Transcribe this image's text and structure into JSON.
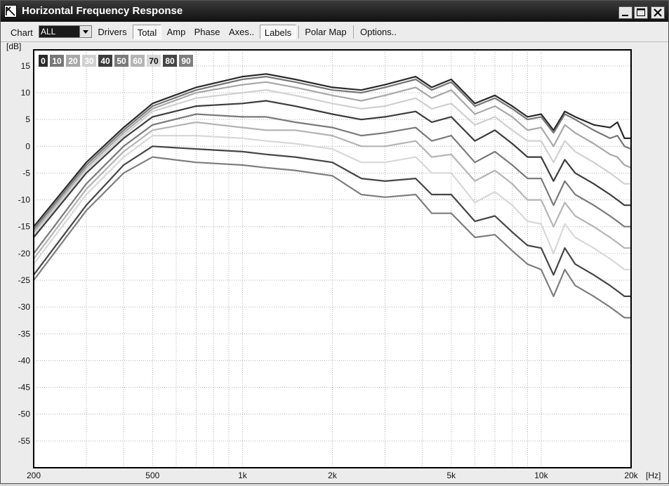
{
  "window": {
    "title": "Horizontal Frequency Response"
  },
  "toolbar": {
    "chart_label": "Chart",
    "chart_select_value": "ALL",
    "drivers": "Drivers",
    "total": "Total",
    "amp": "Amp",
    "phase": "Phase",
    "axes": "Axes..",
    "labels": "Labels",
    "polar_map": "Polar Map",
    "options": "Options.."
  },
  "chart_data": {
    "type": "line",
    "xscale": "log",
    "xlim": [
      200,
      20000
    ],
    "ylim": [
      -60,
      18
    ],
    "grid": true,
    "xunit": "[Hz]",
    "yunit": "[dB]",
    "x_ticks": [
      {
        "value": 200,
        "label": "200"
      },
      {
        "value": 500,
        "label": "500"
      },
      {
        "value": 1000,
        "label": "1k"
      },
      {
        "value": 2000,
        "label": "2k"
      },
      {
        "value": 5000,
        "label": "5k"
      },
      {
        "value": 10000,
        "label": "10k"
      },
      {
        "value": 20000,
        "label": "20k"
      }
    ],
    "y_ticks": [
      {
        "value": 15,
        "label": "15"
      },
      {
        "value": 10,
        "label": "10"
      },
      {
        "value": 5,
        "label": "5"
      },
      {
        "value": 0,
        "label": "0"
      },
      {
        "value": -5,
        "label": "-5"
      },
      {
        "value": -10,
        "label": "-10"
      },
      {
        "value": -15,
        "label": "-15"
      },
      {
        "value": -20,
        "label": "-20"
      },
      {
        "value": -25,
        "label": "-25"
      },
      {
        "value": -30,
        "label": "-30"
      },
      {
        "value": -35,
        "label": "-35"
      },
      {
        "value": -40,
        "label": "-40"
      },
      {
        "value": -45,
        "label": "-45"
      },
      {
        "value": -50,
        "label": "-50"
      },
      {
        "value": -55,
        "label": "-55"
      }
    ],
    "legend_placement": "top-left",
    "x": [
      200,
      300,
      400,
      500,
      700,
      1000,
      1200,
      1500,
      2000,
      2500,
      3000,
      3800,
      4300,
      5000,
      6000,
      7000,
      8000,
      9000,
      10000,
      11000,
      12000,
      13000,
      15000,
      17000,
      18000,
      19000,
      20000
    ],
    "series": [
      {
        "name": "0",
        "color": "#2a2a2a",
        "label_text": "#ffffff",
        "values": [
          -15,
          -3,
          3.5,
          8,
          11,
          13,
          13.5,
          12.5,
          11,
          10.5,
          11.5,
          13,
          11,
          12.5,
          8,
          9.5,
          7.5,
          5.5,
          6,
          3,
          6.5,
          5.5,
          4,
          3.5,
          4.5,
          1.5,
          1.5
        ]
      },
      {
        "name": "10",
        "color": "#777777",
        "label_text": "#ffffff",
        "values": [
          -15.5,
          -3.5,
          3,
          7.5,
          10.5,
          12.5,
          13,
          12,
          10.5,
          10,
          11,
          12.5,
          10.5,
          12,
          7.5,
          9,
          7,
          5,
          5.5,
          2.5,
          6,
          5,
          3,
          1.5,
          2,
          0,
          -0.5
        ]
      },
      {
        "name": "20",
        "color": "#a8a8a8",
        "label_text": "#ffffff",
        "values": [
          -16,
          -4,
          2.5,
          7,
          10,
          11.5,
          12,
          11,
          9.5,
          8.5,
          9.5,
          11,
          9,
          10.5,
          6,
          7.5,
          5.5,
          3,
          3.5,
          0,
          4,
          2.5,
          0.5,
          -1.5,
          -2,
          -3.5,
          -4
        ]
      },
      {
        "name": "30",
        "color": "#d0d0d0",
        "label_text": "#ffffff",
        "values": [
          -16.5,
          -4.5,
          2,
          6.5,
          9,
          10,
          10.5,
          9.5,
          8,
          7,
          7.5,
          9,
          7,
          8,
          4,
          5.5,
          3,
          1,
          1,
          -3,
          1,
          -1,
          -3,
          -5,
          -6,
          -7,
          -7
        ]
      },
      {
        "name": "40",
        "color": "#3c3c3c",
        "label_text": "#ffffff",
        "values": [
          -17,
          -5,
          1.5,
          5.5,
          7.5,
          8,
          8.5,
          7.5,
          6,
          5,
          5.5,
          6.5,
          4.5,
          5.5,
          1,
          3,
          0.5,
          -2,
          -2,
          -6.5,
          -2.5,
          -5,
          -7,
          -9,
          -10,
          -11,
          -11
        ]
      },
      {
        "name": "50",
        "color": "#7a7a7a",
        "label_text": "#ffffff",
        "values": [
          -20,
          -7,
          0,
          4,
          6,
          5.5,
          5.5,
          4.5,
          3.5,
          2,
          2.5,
          3.5,
          1,
          2,
          -3,
          -1,
          -3.5,
          -6,
          -6,
          -11,
          -6.5,
          -9,
          -11,
          -13,
          -14,
          -15,
          -15
        ]
      },
      {
        "name": "60",
        "color": "#b4b4b4",
        "label_text": "#ffffff",
        "values": [
          -21,
          -8,
          -1,
          3,
          4.5,
          3.5,
          3,
          3,
          2,
          0,
          0,
          1,
          -2,
          -1.5,
          -6.5,
          -4.5,
          -7,
          -10,
          -10,
          -15,
          -10.5,
          -13,
          -15,
          -17,
          -18,
          -19,
          -19
        ]
      },
      {
        "name": "70",
        "color": "#d8d8d8",
        "label_text": "#111111",
        "values": [
          -22,
          -9,
          -2,
          2,
          2,
          1.5,
          1,
          0.5,
          -0.5,
          -3,
          -3,
          -2,
          -5,
          -5,
          -10.5,
          -8.5,
          -11,
          -14,
          -14.5,
          -20,
          -14.5,
          -17,
          -19,
          -21,
          -22,
          -23,
          -23
        ]
      },
      {
        "name": "80",
        "color": "#454545",
        "label_text": "#ffffff",
        "values": [
          -24,
          -11,
          -3.5,
          0,
          -0.5,
          -1,
          -1.5,
          -2,
          -3,
          -6,
          -6.5,
          -6,
          -9,
          -9,
          -14,
          -13,
          -16,
          -18.5,
          -19,
          -24,
          -19,
          -22,
          -24,
          -26,
          -27,
          -28,
          -28
        ]
      },
      {
        "name": "90",
        "color": "#7e7e7e",
        "label_text": "#ffffff",
        "values": [
          -25,
          -12,
          -5,
          -2,
          -3,
          -3.5,
          -4,
          -4.5,
          -5.5,
          -9,
          -9.5,
          -9,
          -12.5,
          -12.5,
          -17,
          -16.5,
          -19.5,
          -22,
          -23,
          -28,
          -23,
          -26,
          -28,
          -30,
          -31,
          -32,
          -32
        ]
      }
    ]
  }
}
